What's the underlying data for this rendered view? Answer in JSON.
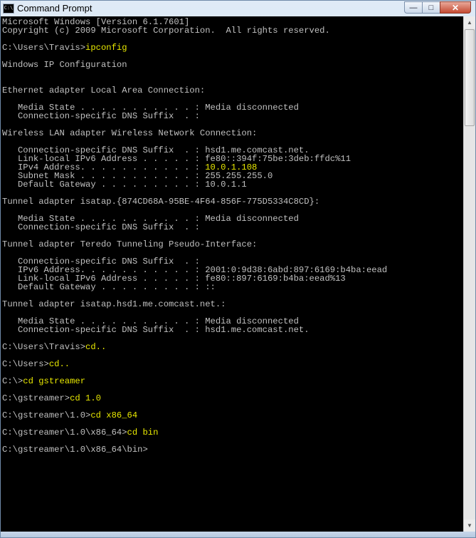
{
  "window": {
    "title": "Command Prompt",
    "icon_label": "C:\\",
    "minimize_glyph": "—",
    "maximize_glyph": "□",
    "close_glyph": "✕"
  },
  "console": {
    "lines": [
      [
        {
          "t": "Microsoft Windows [Version 6.1.7601]"
        }
      ],
      [
        {
          "t": "Copyright (c) 2009 Microsoft Corporation.  All rights reserved."
        }
      ],
      [
        {
          "t": ""
        }
      ],
      [
        {
          "t": "C:\\Users\\Travis>"
        },
        {
          "t": "ipconfig",
          "c": "y"
        }
      ],
      [
        {
          "t": ""
        }
      ],
      [
        {
          "t": "Windows IP Configuration"
        }
      ],
      [
        {
          "t": ""
        }
      ],
      [
        {
          "t": ""
        }
      ],
      [
        {
          "t": "Ethernet adapter Local Area Connection:"
        }
      ],
      [
        {
          "t": ""
        }
      ],
      [
        {
          "t": "   Media State . . . . . . . . . . . : Media disconnected"
        }
      ],
      [
        {
          "t": "   Connection-specific DNS Suffix  . :"
        }
      ],
      [
        {
          "t": ""
        }
      ],
      [
        {
          "t": "Wireless LAN adapter Wireless Network Connection:"
        }
      ],
      [
        {
          "t": ""
        }
      ],
      [
        {
          "t": "   Connection-specific DNS Suffix  . : hsd1.me.comcast.net."
        }
      ],
      [
        {
          "t": "   Link-local IPv6 Address . . . . . : fe80::394f:75be:3deb:ffdc%11"
        }
      ],
      [
        {
          "t": "   IPv4 Address. . . . . . . . . . . : "
        },
        {
          "t": "10.0.1.108",
          "c": "y"
        }
      ],
      [
        {
          "t": "   Subnet Mask . . . . . . . . . . . : 255.255.255.0"
        }
      ],
      [
        {
          "t": "   Default Gateway . . . . . . . . . : 10.0.1.1"
        }
      ],
      [
        {
          "t": ""
        }
      ],
      [
        {
          "t": "Tunnel adapter isatap.{874CD68A-95BE-4F64-856F-775D5334C8CD}:"
        }
      ],
      [
        {
          "t": ""
        }
      ],
      [
        {
          "t": "   Media State . . . . . . . . . . . : Media disconnected"
        }
      ],
      [
        {
          "t": "   Connection-specific DNS Suffix  . :"
        }
      ],
      [
        {
          "t": ""
        }
      ],
      [
        {
          "t": "Tunnel adapter Teredo Tunneling Pseudo-Interface:"
        }
      ],
      [
        {
          "t": ""
        }
      ],
      [
        {
          "t": "   Connection-specific DNS Suffix  . :"
        }
      ],
      [
        {
          "t": "   IPv6 Address. . . . . . . . . . . : 2001:0:9d38:6abd:897:6169:b4ba:eead"
        }
      ],
      [
        {
          "t": "   Link-local IPv6 Address . . . . . : fe80::897:6169:b4ba:eead%13"
        }
      ],
      [
        {
          "t": "   Default Gateway . . . . . . . . . : ::"
        }
      ],
      [
        {
          "t": ""
        }
      ],
      [
        {
          "t": "Tunnel adapter isatap.hsd1.me.comcast.net.:"
        }
      ],
      [
        {
          "t": ""
        }
      ],
      [
        {
          "t": "   Media State . . . . . . . . . . . : Media disconnected"
        }
      ],
      [
        {
          "t": "   Connection-specific DNS Suffix  . : hsd1.me.comcast.net."
        }
      ],
      [
        {
          "t": ""
        }
      ],
      [
        {
          "t": "C:\\Users\\Travis>"
        },
        {
          "t": "cd..",
          "c": "y"
        }
      ],
      [
        {
          "t": ""
        }
      ],
      [
        {
          "t": "C:\\Users>"
        },
        {
          "t": "cd..",
          "c": "y"
        }
      ],
      [
        {
          "t": ""
        }
      ],
      [
        {
          "t": "C:\\>"
        },
        {
          "t": "cd gstreamer",
          "c": "y"
        }
      ],
      [
        {
          "t": ""
        }
      ],
      [
        {
          "t": "C:\\gstreamer>"
        },
        {
          "t": "cd 1.0",
          "c": "y"
        }
      ],
      [
        {
          "t": ""
        }
      ],
      [
        {
          "t": "C:\\gstreamer\\1.0>"
        },
        {
          "t": "cd x86_64",
          "c": "y"
        }
      ],
      [
        {
          "t": ""
        }
      ],
      [
        {
          "t": "C:\\gstreamer\\1.0\\x86_64>"
        },
        {
          "t": "cd bin",
          "c": "y"
        }
      ],
      [
        {
          "t": ""
        }
      ],
      [
        {
          "t": "C:\\gstreamer\\1.0\\x86_64\\bin>"
        }
      ]
    ]
  },
  "scrollbar": {
    "up_glyph": "▲",
    "down_glyph": "▼",
    "position_fraction": 0.0
  }
}
